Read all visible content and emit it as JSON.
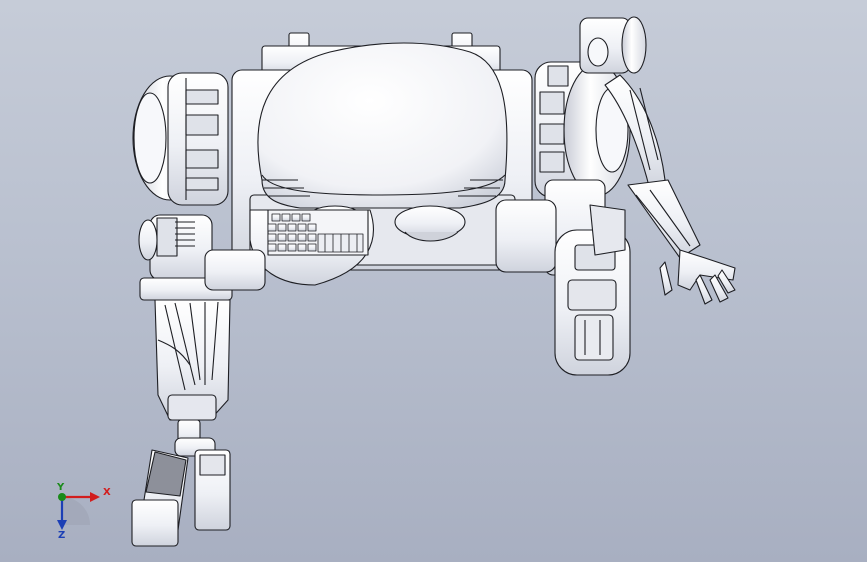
{
  "viewport": {
    "background_top": "#c6ccd8",
    "background_bottom": "#a8afc1",
    "model_face_color": "#f1f2f6",
    "model_edge_color": "#1e1f24"
  },
  "orientation_triad": {
    "x_label": "X",
    "y_label": "Y",
    "z_label": "Z",
    "x_color": "#d21d1d",
    "y_color": "#1a8a1a",
    "z_color": "#1c3fb5"
  }
}
